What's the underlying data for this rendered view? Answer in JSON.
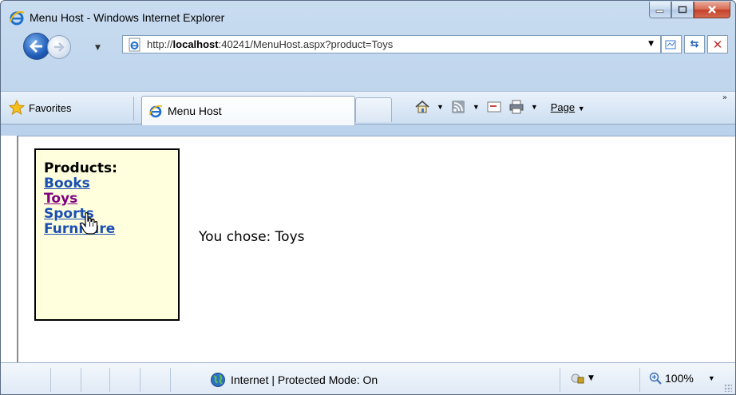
{
  "window": {
    "title": "Menu Host - Windows Internet Explorer"
  },
  "address_bar": {
    "url_prefix": "http://",
    "url_host": "localhost",
    "url_rest": ":40241/MenuHost.aspx?product=Toys"
  },
  "command_bar": {
    "favorites_label": "Favorites",
    "active_tab_label": "Menu Host",
    "page_menu_label": "Page"
  },
  "content": {
    "menu_title": "Products:",
    "menu_items": [
      "Books",
      "Toys",
      "Sports",
      "Furniture"
    ],
    "chosen_text": "You chose: Toys"
  },
  "status_bar": {
    "zone_text": "Internet | Protected Mode: On",
    "zoom_text": "100%"
  },
  "colors": {
    "menu_background": "#ffffdd",
    "link_color": "#1a4fb3",
    "visited_link_color": "#800080"
  }
}
